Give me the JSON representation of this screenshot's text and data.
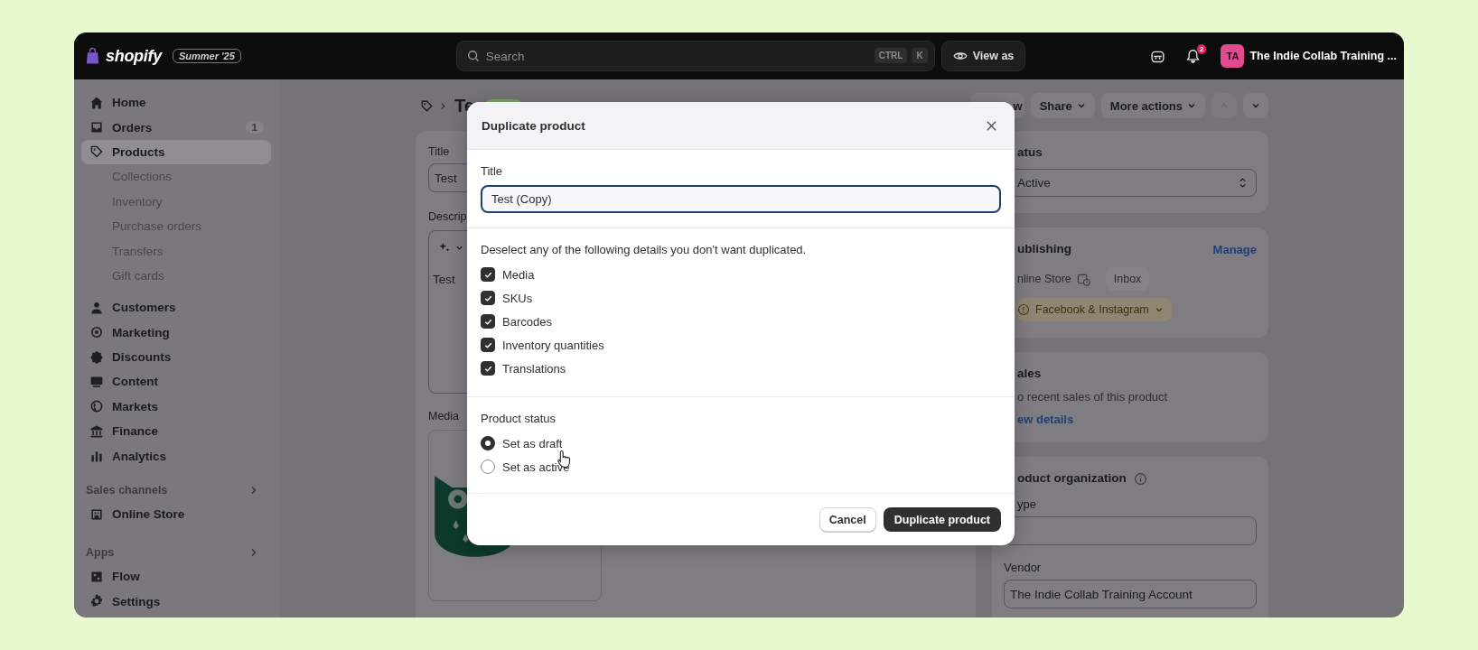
{
  "topbar": {
    "logo": "shopify",
    "edition": "Summer '25",
    "search": {
      "placeholder": "Search",
      "keys": [
        "CTRL",
        "K"
      ]
    },
    "view_as": "View as",
    "notifications": "2",
    "account": {
      "initials": "TA",
      "name": "The Indie Collab Training ..."
    }
  },
  "sidebar": {
    "items": [
      {
        "label": "Home",
        "selected": false
      },
      {
        "label": "Orders",
        "selected": false,
        "badge": "1"
      },
      {
        "label": "Products",
        "selected": true,
        "children": [
          {
            "label": "Collections",
            "selected": false
          },
          {
            "label": "Inventory",
            "selected": false
          },
          {
            "label": "Purchase orders",
            "selected": false
          },
          {
            "label": "Transfers",
            "selected": false
          },
          {
            "label": "Gift cards",
            "selected": false
          }
        ]
      },
      {
        "label": "Customers",
        "selected": false
      },
      {
        "label": "Marketing",
        "selected": false
      },
      {
        "label": "Discounts",
        "selected": false
      },
      {
        "label": "Content",
        "selected": false
      },
      {
        "label": "Markets",
        "selected": false
      },
      {
        "label": "Finance",
        "selected": false
      },
      {
        "label": "Analytics",
        "selected": false
      }
    ],
    "sections": [
      {
        "title": "Sales channels",
        "items": [
          {
            "label": "Online Store",
            "selected": false
          }
        ]
      },
      {
        "title": "Apps",
        "items": [
          {
            "label": "Flow",
            "selected": false
          }
        ]
      }
    ],
    "settings": {
      "label": "Settings",
      "selected": false
    }
  },
  "page": {
    "title": "Te",
    "header_buttons": [
      {
        "label": "w",
        "caret": false
      },
      {
        "label": "Share",
        "caret": true
      },
      {
        "label": "More actions",
        "caret": true
      }
    ],
    "left": {
      "title_label": "Title",
      "title_value": "Test",
      "description_label": "Descrip",
      "description_value": "Test",
      "media_label": "Media"
    },
    "status": {
      "heading": "atus",
      "value": "Active"
    },
    "publishing": {
      "heading": "ublishing",
      "link": "Manage",
      "channels": [
        {
          "name": "nline Store",
          "kind": "scheduled"
        },
        {
          "name": "Inbox",
          "kind": "plain"
        },
        {
          "name": "Facebook & Instagram",
          "kind": "warning"
        }
      ]
    },
    "sales": {
      "heading": "ales",
      "text": "o recent sales of this product",
      "link": "ew details"
    },
    "organization": {
      "heading": "oduct organization",
      "type_label": "ype",
      "vendor_label": "Vendor",
      "vendor_value": "The Indie Collab Training Account"
    }
  },
  "modal": {
    "title": "Duplicate product",
    "title_field": {
      "label": "Title",
      "value": "Test (Copy)"
    },
    "options_intro": "Deselect any of the following details you don't want duplicated.",
    "options": [
      {
        "label": "Media",
        "checked": true
      },
      {
        "label": "SKUs",
        "checked": true
      },
      {
        "label": "Barcodes",
        "checked": true
      },
      {
        "label": "Inventory quantities",
        "checked": true
      },
      {
        "label": "Translations",
        "checked": true
      }
    ],
    "status": {
      "label": "Product status",
      "options": [
        {
          "label": "Set as draft",
          "selected": true
        },
        {
          "label": "Set as active",
          "selected": false
        }
      ]
    },
    "buttons": {
      "cancel": "Cancel",
      "confirm": "Duplicate product"
    }
  }
}
